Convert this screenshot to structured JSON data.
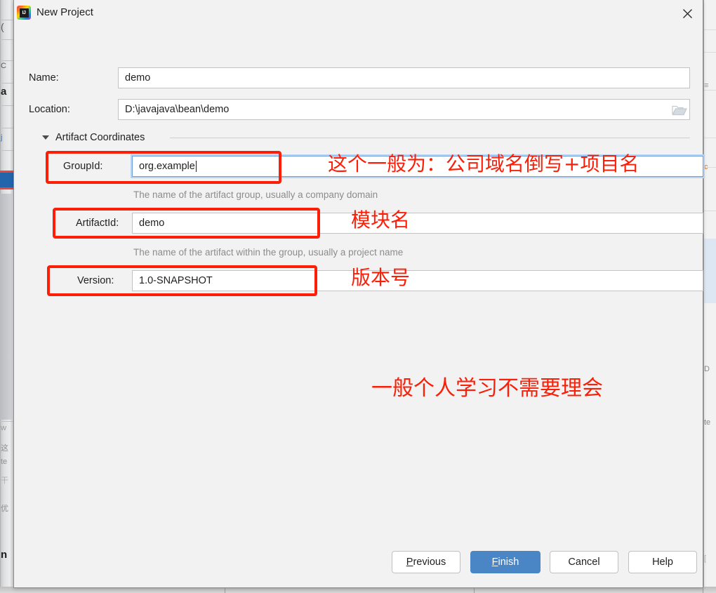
{
  "window": {
    "title": "New Project",
    "app_icon": "intellij-idea-icon",
    "icon_text": "IJ",
    "close_icon": "close-icon"
  },
  "form": {
    "name": {
      "label": "Name:",
      "value": "demo"
    },
    "location": {
      "label": "Location:",
      "value": "D:\\javajava\\bean\\demo",
      "browse_icon": "folder-icon"
    },
    "section": {
      "label": "Artifact Coordinates",
      "expanded": true,
      "collapse_icon": "triangle-down-icon"
    },
    "group_id": {
      "label": "GroupId:",
      "value": "org.example",
      "focused": true,
      "hint": "The name of the artifact group, usually a company domain"
    },
    "artifact_id": {
      "label": "ArtifactId:",
      "value": "demo",
      "hint": "The name of the artifact within the group, usually a project name"
    },
    "version": {
      "label": "Version:",
      "value": "1.0-SNAPSHOT"
    }
  },
  "annotations": {
    "color": "#fb1f08",
    "group_id_note": "这个一般为：公司域名倒写+项目名",
    "artifact_id_note": "模块名",
    "version_note": "版本号",
    "general_note": "一般个人学习不需要理会"
  },
  "footer": {
    "previous": {
      "pre": "",
      "mnemonic": "P",
      "post": "revious"
    },
    "finish": {
      "pre": "",
      "mnemonic": "F",
      "post": "inish"
    },
    "cancel": {
      "label": "Cancel"
    },
    "help": {
      "label": "Help"
    }
  },
  "colors": {
    "primary_button": "#4a86c5",
    "dialog_bg": "#f2f2f2",
    "annotation_red": "#fb1f08",
    "focus_blue": "#6ea3dd"
  }
}
